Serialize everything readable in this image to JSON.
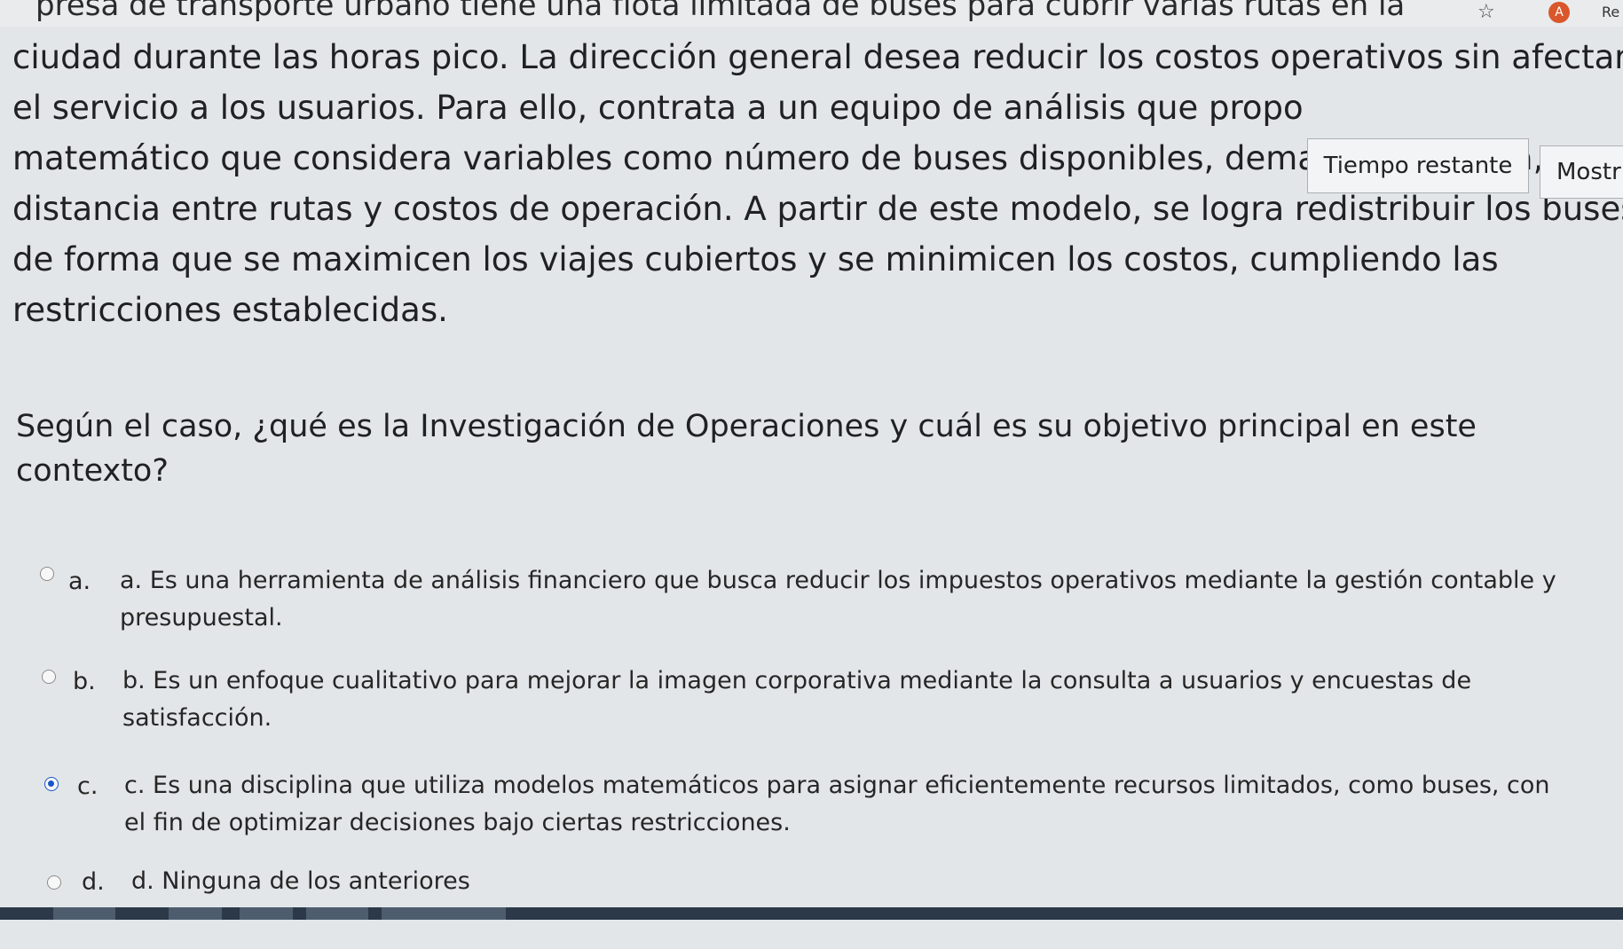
{
  "browser": {
    "star_icon": "star-outline-icon",
    "avatar_letter": "A",
    "tab_fragment": "Re"
  },
  "case_text": {
    "line0": "presa de transporte urbano tiene una flota limitada de buses para cubrir varias rutas en la",
    "line1": "ciudad durante las horas pico. La dirección general desea reducir los costos operativos sin afectar",
    "line2": "el servicio a los usuarios. Para ello, contrata a un equipo de análisis que propo",
    "line3": "matemático que considera variables como número de buses disponibles, demanda por zona,",
    "line4": "distancia entre rutas y costos de operación. A partir de este modelo, se logra redistribuir los buses",
    "line5": "de forma que se maximicen los viajes cubiertos y se minimicen los costos, cumpliendo las",
    "line6": "restricciones establecidas."
  },
  "timer_label": "Tiempo restante",
  "show_button_label": "Mostr",
  "question": {
    "line1": "Según el caso, ¿qué es la Investigación de Operaciones y cuál es su objetivo principal en este",
    "line2": "contexto?"
  },
  "options": [
    {
      "letter": "a.",
      "line1": "a. Es una herramienta de análisis financiero que busca reducir los impuestos operativos mediante la gestión contable y",
      "line2": "presupuestal.",
      "selected": false
    },
    {
      "letter": "b.",
      "line1": "b. Es un enfoque cualitativo para mejorar la imagen corporativa mediante la consulta a usuarios y encuestas de",
      "line2": "satisfacción.",
      "selected": false
    },
    {
      "letter": "c.",
      "line1": "c. Es una disciplina que utiliza modelos matemáticos para asignar eficientemente recursos limitados, como buses, con",
      "line2": "el fin de optimizar decisiones bajo ciertas restricciones.",
      "selected": true
    },
    {
      "letter": "d.",
      "line1": "d. Ninguna de los anteriores",
      "line2": "",
      "selected": false
    }
  ],
  "colors": {
    "radio_selected": "#1a55c9",
    "background": "#e3e6e8",
    "taskbar": "#2b3948"
  }
}
